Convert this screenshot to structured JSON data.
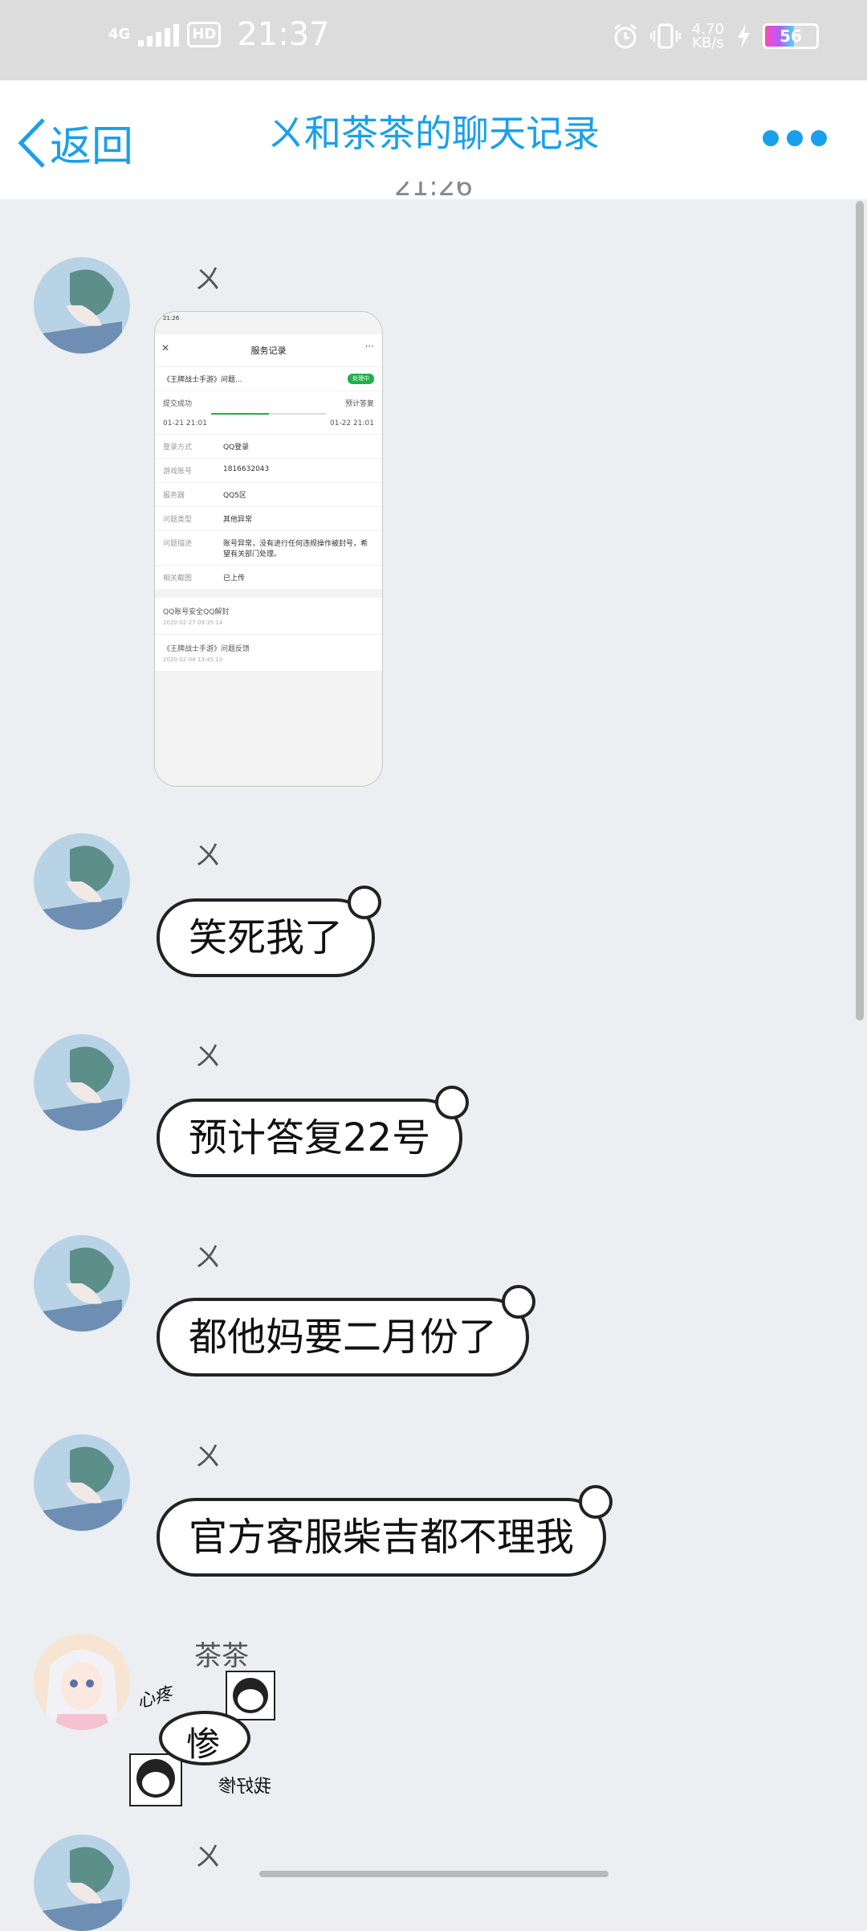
{
  "status_bar": {
    "network": "4G",
    "hd": "HD",
    "time": "21:37",
    "speed_value": "4.70",
    "speed_unit": "KB/s",
    "battery": "56",
    "battery_level": 0.56
  },
  "header": {
    "back_label": "返回",
    "title": "ㄨ和茶茶的聊天记录"
  },
  "chat": {
    "partial_time": "21:26",
    "messages": [
      {
        "sender": "ㄨ",
        "type": "image"
      },
      {
        "sender": "ㄨ",
        "text": "笑死我了"
      },
      {
        "sender": "ㄨ",
        "text": "预计答复22号"
      },
      {
        "sender": "ㄨ",
        "text": "都他妈要二月份了"
      },
      {
        "sender": "ㄨ",
        "text": "官方客服柴吉都不理我"
      },
      {
        "sender": "茶茶",
        "type": "sticker",
        "text": "惨"
      },
      {
        "sender": "ㄨ"
      }
    ]
  },
  "image_message": {
    "status": "21:26",
    "title": "服务记录",
    "summary": "《王牌战士手游》问题...",
    "badge": "处理中",
    "step_left": "提交成功",
    "step_left_date": "01-21 21:01",
    "step_right": "预计答复",
    "step_right_date": "01-22 21:01",
    "rows": [
      {
        "k": "登录方式",
        "v": "QQ登录"
      },
      {
        "k": "游戏账号",
        "v": "1816632043"
      },
      {
        "k": "服务器",
        "v": "QQ5区"
      },
      {
        "k": "问题类型",
        "v": "其他异常"
      },
      {
        "k": "问题描述",
        "v": "账号异常，没有进行任何违规操作被封号，希望有关部门处理。"
      },
      {
        "k": "相关截图",
        "v": "已上传"
      }
    ],
    "links": [
      {
        "title": "QQ账号安全QQ解封",
        "time": "2020-02-27 09:35:14"
      },
      {
        "title": "《王牌战士手游》问题反馈",
        "time": "2020-02-08 13:45:10"
      }
    ]
  },
  "sticker": {
    "text": "惨",
    "side_left": "心疼",
    "side_right": "我好惨"
  },
  "colors": {
    "accent": "#1aa0ea",
    "background": "#eceef2"
  }
}
